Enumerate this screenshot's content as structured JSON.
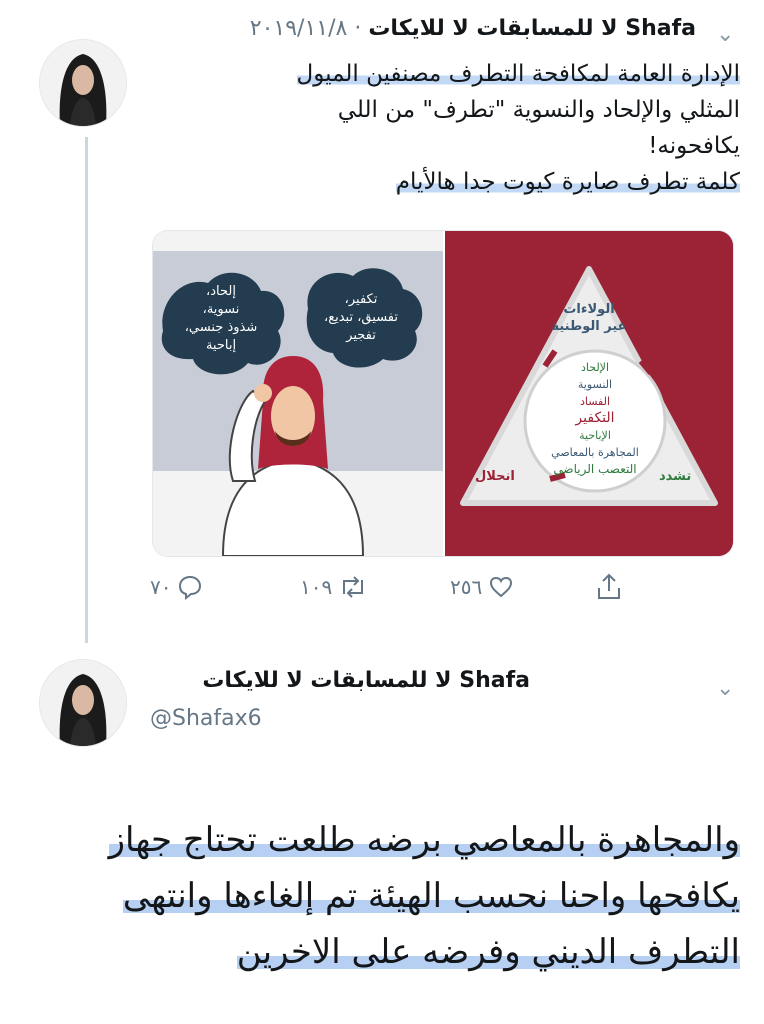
{
  "tweet1": {
    "display_name": "Shafa لا للمسابقات لا للايكات",
    "date": "٢٠١٩/١١/٨",
    "separator": "·",
    "lines": [
      "الإدارة العامة لمكافحة التطرف مصنفين الميول",
      "المثلي  والإلحاد والنسوية \"تطرف\" من اللي",
      "يكافحونه!",
      "كلمة تطرف صايرة كيوت جدا هالأيام"
    ],
    "media": {
      "left_bubble_1": [
        "إلحاد،",
        "نسوية،",
        "شذوذ جنسي،",
        "إباحية"
      ],
      "left_bubble_2": [
        "تكفير،",
        "تفسيق، تبديع،",
        "تفجير"
      ],
      "triangle_top": [
        "الولاءات",
        "غير الوطنية"
      ],
      "triangle_left": "انحلال",
      "triangle_right": "تشدد",
      "circle_words": [
        "الإلحاد",
        "التكفير",
        "الإباحية",
        "التعصب الرياضي",
        "المجاهرة بالمعاصي",
        "الفساد",
        "النسوية"
      ]
    },
    "actions": {
      "reply_count": "٧٠",
      "retweet_count": "١٠٩",
      "like_count": "٢٥٦"
    }
  },
  "tweet2": {
    "display_name": "Shafa لا للمسابقات لا للايكات",
    "handle": "@Shafax6",
    "lines": [
      "والمجاهرة بالمعاصي برضه طلعت تحتاج جهاز",
      "يكافحها واحنا نحسب الهيئة تم إلغاءها وانتهى",
      "التطرف الديني وفرضه على الاخرين"
    ]
  },
  "colors": {
    "highlight": "#78aaeb",
    "maroon": "#9b2335",
    "meta_gray": "#657786"
  },
  "icons": [
    "chevron-down-icon",
    "reply-icon",
    "retweet-icon",
    "like-icon",
    "share-icon"
  ]
}
